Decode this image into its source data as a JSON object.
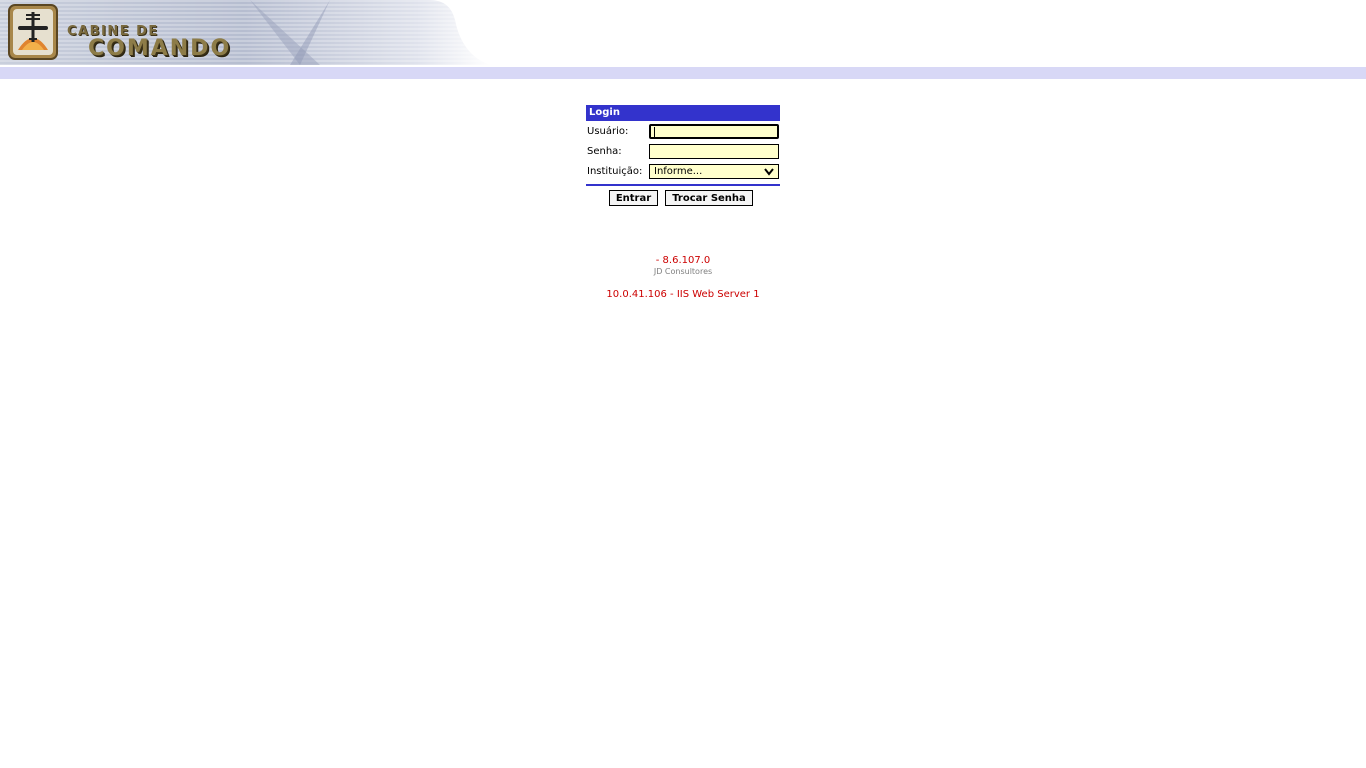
{
  "header": {
    "logo_line1": "Cabine de",
    "logo_line2": "Comando",
    "logo_icon": "airplane-emblem-icon",
    "colors": {
      "rule": "#3a3aa8",
      "band": "#d8d8f6"
    }
  },
  "login": {
    "title": "Login",
    "usuario_label": "Usuário:",
    "usuario_value": "",
    "senha_label": "Senha:",
    "senha_value": "",
    "instituicao_label": "Instituição:",
    "instituicao_selected": "Informe...",
    "entrar_label": "Entrar",
    "trocar_senha_label": "Trocar Senha",
    "colors": {
      "title_bg": "#3333cc",
      "input_bg": "#ffffcc"
    }
  },
  "footer": {
    "version": "- 8.6.107.0",
    "company": "JD Consultores",
    "server": "10.0.41.106 - IIS Web Server 1"
  }
}
